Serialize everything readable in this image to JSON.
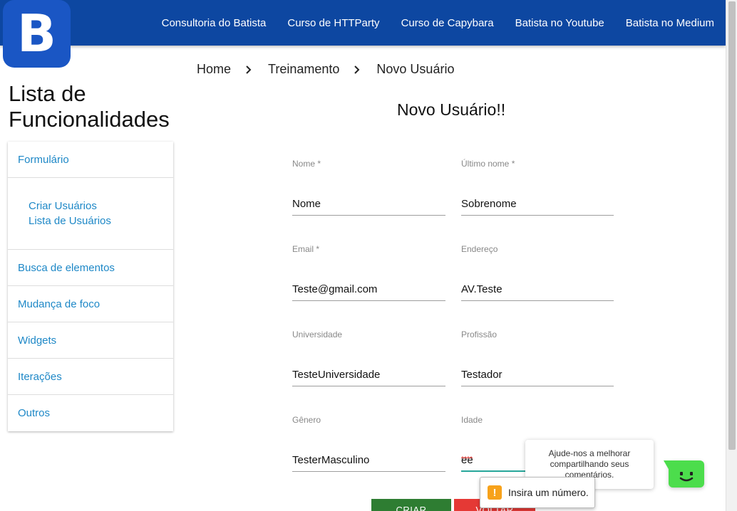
{
  "logo": {
    "letter": "B"
  },
  "nav": {
    "links": [
      "Consultoria do Batista",
      "Curso de HTTParty",
      "Curso de Capybara",
      "Batista no Youtube",
      "Batista no Medium"
    ]
  },
  "breadcrumb": {
    "items": [
      "Home",
      "Treinamento",
      "Novo Usuário"
    ]
  },
  "sidebar": {
    "title_line1": "Lista de",
    "title_line2": "Funcionalidades",
    "items": [
      {
        "label": "Formulário"
      },
      {
        "label": "Busca de elementos"
      },
      {
        "label": "Mudança de foco"
      },
      {
        "label": "Widgets"
      },
      {
        "label": "Iterações"
      },
      {
        "label": "Outros"
      }
    ],
    "sub_items": [
      "Criar Usuários",
      "Lista de Usuários"
    ]
  },
  "form": {
    "title": "Novo Usuário!!",
    "fields": [
      {
        "label": "Nome *",
        "value": "Nome"
      },
      {
        "label": "Último nome *",
        "value": "Sobrenome"
      },
      {
        "label": "Email *",
        "value": "Teste@gmail.com"
      },
      {
        "label": "Endereço",
        "value": "AV.Teste"
      },
      {
        "label": "Universidade",
        "value": "TesteUniversidade"
      },
      {
        "label": "Profissão",
        "value": "Testador"
      },
      {
        "label": "Gênero",
        "value": "TesterMasculino"
      },
      {
        "label": "Idade",
        "value": "ee"
      }
    ],
    "validation_message": "Insira um número.",
    "create_label": "CRIAR",
    "back_label": "VOLTAR"
  },
  "feedback": {
    "text": "Ajude-nos a melhorar compartilhando seus comentários."
  },
  "colors": {
    "navbar": "#0d47a1",
    "logo": "#1a56c4",
    "link": "#1e88c7",
    "create_button": "#2e7d32",
    "back_button": "#e53935",
    "active_underline": "#26a69a",
    "feedback_button": "#4cdd4c",
    "warning": "#f7a21b"
  }
}
